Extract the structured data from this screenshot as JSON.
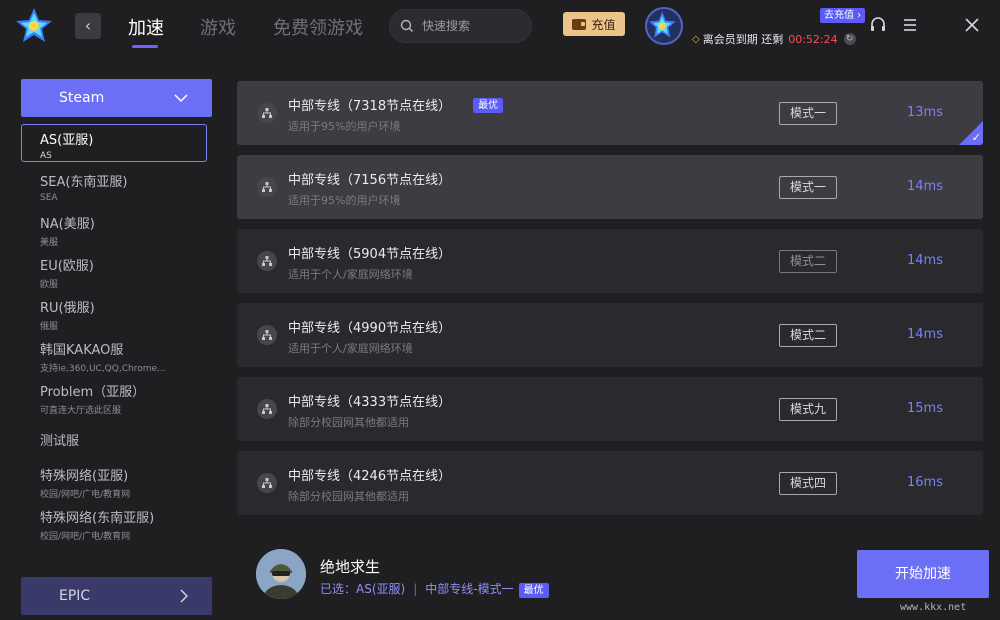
{
  "header": {
    "tabs": [
      {
        "label": "加速",
        "active": true
      },
      {
        "label": "游戏",
        "active": false
      },
      {
        "label": "免费领游戏",
        "active": false
      }
    ],
    "search_placeholder": "快速搜索",
    "recharge_label": "充值",
    "topup_badge": "去充值",
    "vip_text": "离会员到期 还剩",
    "vip_timer": "00:52:24",
    "icons": [
      "back-icon",
      "search-icon",
      "wallet-icon",
      "diamond-icon",
      "refresh-icon",
      "headset-icon",
      "menu-icon",
      "close-icon"
    ]
  },
  "sidebar": {
    "platform_top": "Steam",
    "platform_bottom": "EPIC",
    "regions": [
      {
        "name": "AS(亚服)",
        "sub": "AS",
        "selected": true
      },
      {
        "name": "SEA(东南亚服)",
        "sub": "SEA"
      },
      {
        "name": "NA(美服)",
        "sub": "美服"
      },
      {
        "name": "EU(欧服)",
        "sub": "欧服"
      },
      {
        "name": "RU(俄服)",
        "sub": "俄服"
      },
      {
        "name": "韩国KAKAO服",
        "sub": "支持ie,360,UC,QQ,Chrome..."
      },
      {
        "name": "Problem（亚服）",
        "sub": "可直连大厅选此区服"
      },
      {
        "name": "测试服",
        "sub": ""
      },
      {
        "name": "特殊网络(亚服)",
        "sub": "校园/网吧/广电/教育网"
      },
      {
        "name": "特殊网络(东南亚服)",
        "sub": "校园/网吧/广电/教育网"
      }
    ]
  },
  "nodes": [
    {
      "title": "中部专线（7318节点在线）",
      "desc": "适用于95%的用户环境",
      "mode": "模式一",
      "ping": "13ms",
      "best": "最优",
      "selected": true
    },
    {
      "title": "中部专线（7156节点在线）",
      "desc": "适用于95%的用户环境",
      "mode": "模式一",
      "ping": "14ms",
      "best": "",
      "selected": false
    },
    {
      "title": "中部专线（5904节点在线）",
      "desc": "适用于个人/家庭网络环境",
      "mode": "模式二",
      "ping": "14ms",
      "best": "",
      "selected": false
    },
    {
      "title": "中部专线（4990节点在线）",
      "desc": "适用于个人/家庭网络环境",
      "mode": "模式二",
      "ping": "14ms",
      "best": "",
      "selected": false
    },
    {
      "title": "中部专线（4333节点在线）",
      "desc": "除部分校园网其他都适用",
      "mode": "模式九",
      "ping": "15ms",
      "best": "",
      "selected": false
    },
    {
      "title": "中部专线（4246节点在线）",
      "desc": "除部分校园网其他都适用",
      "mode": "模式四",
      "ping": "16ms",
      "best": "",
      "selected": false
    }
  ],
  "footer": {
    "game_title": "绝地求生",
    "selected_prefix": "已选：",
    "selected_region": "AS(亚服)",
    "separator": "|",
    "selected_line": "中部专线-模式一",
    "best": "最优",
    "start_label": "开始加速",
    "watermark": "www.kkx.net"
  },
  "colors": {
    "accent": "#6b6ff6",
    "ping": "#7c7ff8",
    "timer": "#ff4d4d",
    "recharge": "#ecc48b",
    "background": "#1f1f22"
  }
}
